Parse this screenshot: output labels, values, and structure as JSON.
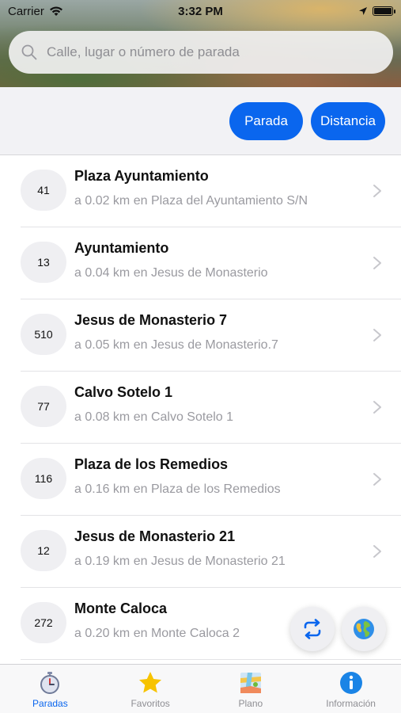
{
  "status_bar": {
    "carrier": "Carrier",
    "time": "3:32 PM"
  },
  "search": {
    "placeholder": "Calle, lugar o número de parada"
  },
  "filters": {
    "stop_label": "Parada",
    "distance_label": "Distancia"
  },
  "stops": [
    {
      "number": "41",
      "name": "Plaza Ayuntamiento",
      "detail": "a 0.02 km en Plaza del Ayuntamiento S/N"
    },
    {
      "number": "13",
      "name": "Ayuntamiento",
      "detail": "a 0.04 km en Jesus de Monasterio"
    },
    {
      "number": "510",
      "name": "Jesus de Monasterio 7",
      "detail": "a 0.05 km en Jesus de Monasterio.7"
    },
    {
      "number": "77",
      "name": "Calvo Sotelo 1",
      "detail": "a 0.08 km en Calvo Sotelo 1"
    },
    {
      "number": "116",
      "name": "Plaza de los Remedios",
      "detail": "a 0.16 km en Plaza de los Remedios"
    },
    {
      "number": "12",
      "name": "Jesus de Monasterio 21",
      "detail": "a 0.19 km en Jesus de Monasterio 21"
    },
    {
      "number": "272",
      "name": "Monte Caloca",
      "detail": "a 0.20 km en Monte Caloca 2"
    }
  ],
  "tabs": [
    {
      "label": "Paradas",
      "icon": "stopwatch-icon",
      "active": true
    },
    {
      "label": "Favoritos",
      "icon": "star-icon",
      "active": false
    },
    {
      "label": "Plano",
      "icon": "map-icon",
      "active": false
    },
    {
      "label": "Información",
      "icon": "info-icon",
      "active": false
    }
  ],
  "colors": {
    "accent": "#0a66ee",
    "star": "#f7c300",
    "inactive": "#8e8e93"
  }
}
